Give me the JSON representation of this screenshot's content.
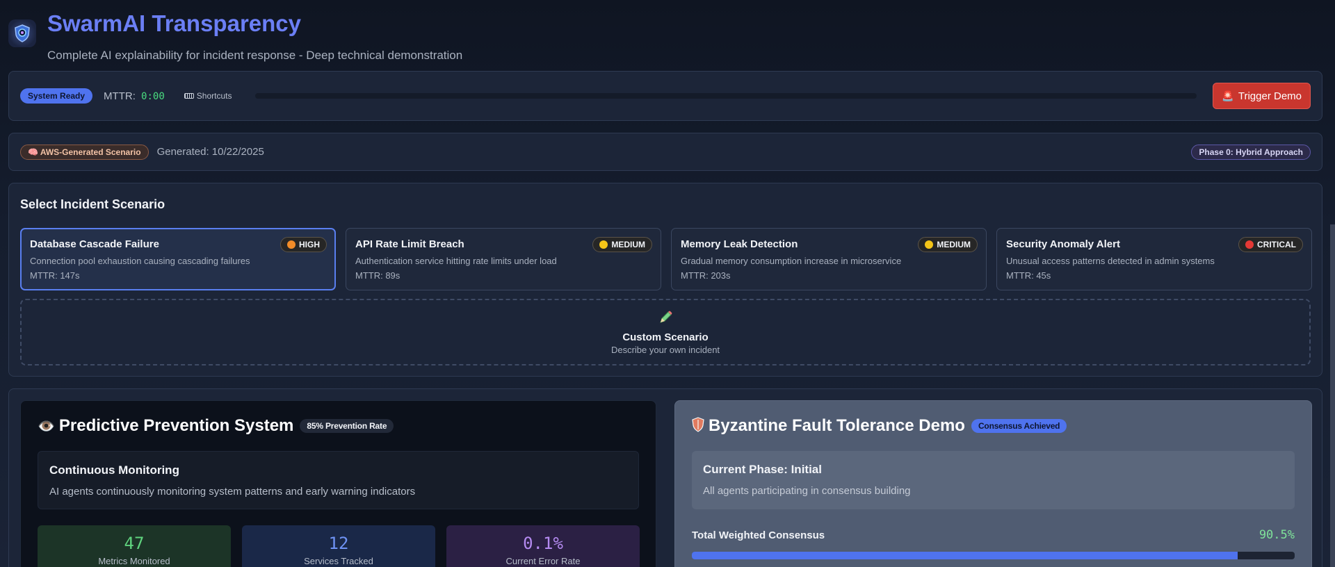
{
  "app": {
    "title": "SwarmAI Transparency",
    "subtitle": "Complete AI explainability for incident response - Deep technical demonstration"
  },
  "status": {
    "ready_label": "System Ready",
    "mttr_label": "MTTR:",
    "mttr_value": "0:00",
    "shortcuts_label": "Shortcuts",
    "progress": 0,
    "trigger_label": "Trigger Demo"
  },
  "meta": {
    "source_label": "AWS-Generated Scenario",
    "generated_label": "Generated: 10/22/2025",
    "phase_label": "Phase 0: Hybrid Approach"
  },
  "scenarios": {
    "title": "Select Incident Scenario",
    "items": [
      {
        "title": "Database Cascade Failure",
        "severity": "HIGH",
        "severity_color": "#f28c28",
        "desc": "Connection pool exhaustion causing cascading failures",
        "mttr": "MTTR: 147s",
        "selected": true
      },
      {
        "title": "API Rate Limit Breach",
        "severity": "MEDIUM",
        "severity_color": "#f5c518",
        "desc": "Authentication service hitting rate limits under load",
        "mttr": "MTTR: 89s",
        "selected": false
      },
      {
        "title": "Memory Leak Detection",
        "severity": "MEDIUM",
        "severity_color": "#f5c518",
        "desc": "Gradual memory consumption increase in microservice",
        "mttr": "MTTR: 203s",
        "selected": false
      },
      {
        "title": "Security Anomaly Alert",
        "severity": "CRITICAL",
        "severity_color": "#e53935",
        "desc": "Unusual access patterns detected in admin systems",
        "mttr": "MTTR: 45s",
        "selected": false
      }
    ],
    "custom": {
      "title": "Custom Scenario",
      "subtitle": "Describe your own incident"
    }
  },
  "prevention": {
    "title": "Predictive Prevention System",
    "badge": "85% Prevention Rate",
    "box_title": "Continuous Monitoring",
    "box_text": "AI agents continuously monitoring system patterns and early warning indicators",
    "metrics": [
      {
        "value": "47",
        "label": "Metrics Monitored"
      },
      {
        "value": "12",
        "label": "Services Tracked"
      },
      {
        "value": "0.1%",
        "label": "Current Error Rate"
      }
    ]
  },
  "byzantine": {
    "title": "Byzantine Fault Tolerance Demo",
    "badge": "Consensus Achieved",
    "box_title": "Current Phase: Initial",
    "box_text": "All agents participating in consensus building",
    "consensus_label": "Total Weighted Consensus",
    "consensus_value": "90.5%",
    "consensus_fraction": 0.905
  },
  "icons": {
    "logo": "shield-logo-icon",
    "shortcuts": "keyboard-icon",
    "trigger": "siren-icon",
    "aws": "brain-icon",
    "custom": "pencil-icon",
    "prevention": "eye-icon",
    "byzantine": "shield-icon"
  }
}
